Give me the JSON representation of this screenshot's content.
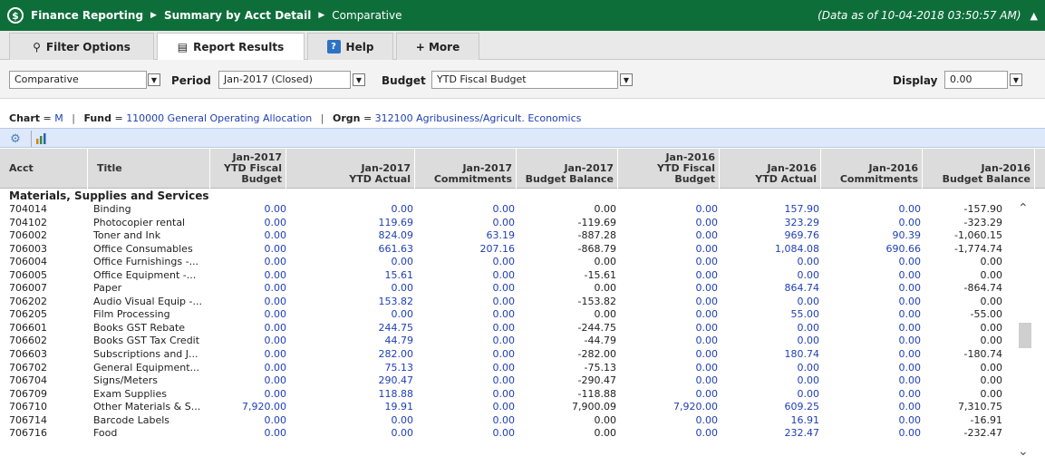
{
  "titlebar": {
    "app": "Finance Reporting",
    "report": "Summary by Acct Detail",
    "view": "Comparative",
    "as_of": "(Data as of 10-04-2018 03:50:57 AM)"
  },
  "tabs": [
    {
      "label": "Filter Options",
      "icon": "search-icon"
    },
    {
      "label": "Report Results",
      "icon": "report-icon"
    },
    {
      "label": "Help",
      "icon": "help-icon"
    },
    {
      "label": "+ More",
      "icon": ""
    }
  ],
  "params": {
    "report_type": "Comparative",
    "period_label": "Period",
    "period": "Jan-2017 (Closed)",
    "budget_label": "Budget",
    "budget": "YTD Fiscal Budget",
    "display_label": "Display",
    "display": "0.00"
  },
  "info": {
    "chart_label": "Chart",
    "chart_value": "M",
    "fund_label": "Fund",
    "fund_value": "110000 General Operating Allocation",
    "orgn_label": "Orgn",
    "orgn_value": "312100 Agribusiness/Agricult. Economics"
  },
  "columns": {
    "acct": "Acct",
    "title": "Title",
    "c1": [
      "Jan-2017",
      "YTD Fiscal",
      "Budget"
    ],
    "c2": [
      "Jan-2017",
      "YTD Actual"
    ],
    "c3": [
      "Jan-2017",
      "Commitments"
    ],
    "c4": [
      "Jan-2017",
      "Budget Balance"
    ],
    "c5": [
      "Jan-2016",
      "YTD Fiscal",
      "Budget"
    ],
    "c6": [
      "Jan-2016",
      "YTD Actual"
    ],
    "c7": [
      "Jan-2016",
      "Commitments"
    ],
    "c8": [
      "Jan-2016",
      "Budget Balance"
    ]
  },
  "section": "Materials, Supplies and Services",
  "rows": [
    {
      "acct": "704014",
      "title": "Binding",
      "v": [
        "0.00",
        "0.00",
        "0.00",
        "0.00",
        "0.00",
        "157.90",
        "0.00",
        "-157.90"
      ]
    },
    {
      "acct": "704102",
      "title": "Photocopier rental",
      "v": [
        "0.00",
        "119.69",
        "0.00",
        "-119.69",
        "0.00",
        "323.29",
        "0.00",
        "-323.29"
      ]
    },
    {
      "acct": "706002",
      "title": "Toner and Ink",
      "v": [
        "0.00",
        "824.09",
        "63.19",
        "-887.28",
        "0.00",
        "969.76",
        "90.39",
        "-1,060.15"
      ]
    },
    {
      "acct": "706003",
      "title": "Office Consumables",
      "v": [
        "0.00",
        "661.63",
        "207.16",
        "-868.79",
        "0.00",
        "1,084.08",
        "690.66",
        "-1,774.74"
      ]
    },
    {
      "acct": "706004",
      "title": "Office Furnishings -...",
      "v": [
        "0.00",
        "0.00",
        "0.00",
        "0.00",
        "0.00",
        "0.00",
        "0.00",
        "0.00"
      ]
    },
    {
      "acct": "706005",
      "title": "Office Equipment -...",
      "v": [
        "0.00",
        "15.61",
        "0.00",
        "-15.61",
        "0.00",
        "0.00",
        "0.00",
        "0.00"
      ]
    },
    {
      "acct": "706007",
      "title": "Paper",
      "v": [
        "0.00",
        "0.00",
        "0.00",
        "0.00",
        "0.00",
        "864.74",
        "0.00",
        "-864.74"
      ]
    },
    {
      "acct": "706202",
      "title": "Audio Visual Equip -...",
      "v": [
        "0.00",
        "153.82",
        "0.00",
        "-153.82",
        "0.00",
        "0.00",
        "0.00",
        "0.00"
      ]
    },
    {
      "acct": "706205",
      "title": "Film Processing",
      "v": [
        "0.00",
        "0.00",
        "0.00",
        "0.00",
        "0.00",
        "55.00",
        "0.00",
        "-55.00"
      ]
    },
    {
      "acct": "706601",
      "title": "Books GST Rebate",
      "v": [
        "0.00",
        "244.75",
        "0.00",
        "-244.75",
        "0.00",
        "0.00",
        "0.00",
        "0.00"
      ]
    },
    {
      "acct": "706602",
      "title": "Books GST Tax Credit",
      "v": [
        "0.00",
        "44.79",
        "0.00",
        "-44.79",
        "0.00",
        "0.00",
        "0.00",
        "0.00"
      ]
    },
    {
      "acct": "706603",
      "title": "Subscriptions and J...",
      "v": [
        "0.00",
        "282.00",
        "0.00",
        "-282.00",
        "0.00",
        "180.74",
        "0.00",
        "-180.74"
      ]
    },
    {
      "acct": "706702",
      "title": "General Equipment...",
      "v": [
        "0.00",
        "75.13",
        "0.00",
        "-75.13",
        "0.00",
        "0.00",
        "0.00",
        "0.00"
      ]
    },
    {
      "acct": "706704",
      "title": "Signs/Meters",
      "v": [
        "0.00",
        "290.47",
        "0.00",
        "-290.47",
        "0.00",
        "0.00",
        "0.00",
        "0.00"
      ]
    },
    {
      "acct": "706709",
      "title": "Exam Supplies",
      "v": [
        "0.00",
        "118.88",
        "0.00",
        "-118.88",
        "0.00",
        "0.00",
        "0.00",
        "0.00"
      ]
    },
    {
      "acct": "706710",
      "title": "Other Materials & S...",
      "v": [
        "7,920.00",
        "19.91",
        "0.00",
        "7,900.09",
        "7,920.00",
        "609.25",
        "0.00",
        "7,310.75"
      ]
    },
    {
      "acct": "706714",
      "title": "Barcode Labels",
      "v": [
        "0.00",
        "0.00",
        "0.00",
        "0.00",
        "0.00",
        "16.91",
        "0.00",
        "-16.91"
      ]
    },
    {
      "acct": "706716",
      "title": "Food",
      "v": [
        "0.00",
        "0.00",
        "0.00",
        "0.00",
        "0.00",
        "232.47",
        "0.00",
        "-232.47"
      ]
    }
  ]
}
